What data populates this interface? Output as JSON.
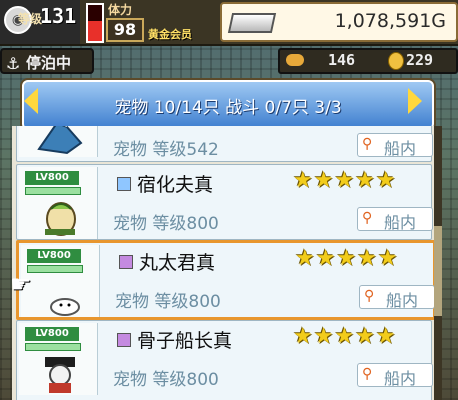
{
  "topbar": {
    "rank_label": "等级",
    "rank_value": "131",
    "hp_fraction": 0.55,
    "stamina_label": "体力",
    "stamina_value": "98",
    "member_label": "黄金会员",
    "gold_value": "1,078,591G",
    "gold_icon": "silver-ingot-icon"
  },
  "status": {
    "label": "停泊中",
    "icon": "anchor-icon"
  },
  "resources": {
    "fish_value": "146",
    "coin_value": "229"
  },
  "header": {
    "title": "宠物 10/14只 战斗 0/7只  3/3"
  },
  "pets": [
    {
      "name": "",
      "type_color": "",
      "sub": "宠物 等级542",
      "loc": "船内",
      "stars": "",
      "level_badge": "",
      "partial": true
    },
    {
      "name": "宿化夫真",
      "type_color": "#8fc6ff",
      "sub": "宠物 等级800",
      "loc": "船内",
      "stars": "★★★★★",
      "level_badge": "LV800"
    },
    {
      "name": "丸太君真",
      "type_color": "#c48ae0",
      "sub": "宠物 等级800",
      "loc": "船内",
      "stars": "★★★★★",
      "level_badge": "LV800",
      "selected": true
    },
    {
      "name": "骨子船长真",
      "type_color": "#c48ae0",
      "sub": "宠物 等级800",
      "loc": "船内",
      "stars": "★★★★★",
      "level_badge": "LV800"
    }
  ],
  "colors": {
    "accent": "#3f7fcf",
    "selection": "#e8962e",
    "star": "#f2cc1b"
  }
}
